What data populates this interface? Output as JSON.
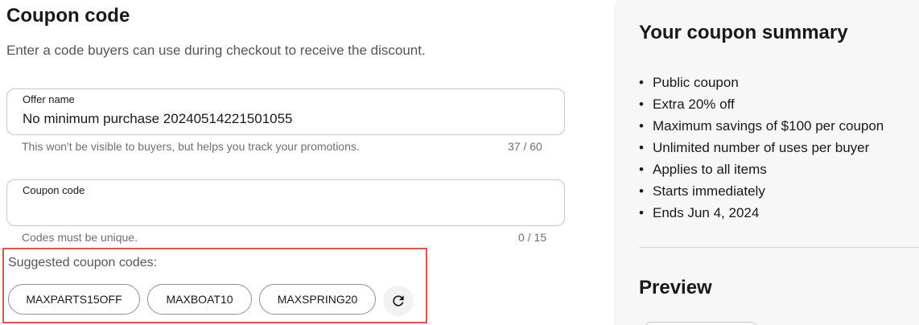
{
  "coupon_section": {
    "title": "Coupon code",
    "description": "Enter a code buyers can use during checkout to receive the discount."
  },
  "offer_name_field": {
    "label": "Offer name",
    "value": "No minimum purchase 20240514221501055",
    "helper": "This won't be visible to buyers, but helps you track your promotions.",
    "counter": "37 / 60"
  },
  "coupon_code_field": {
    "label": "Coupon code",
    "value": "",
    "helper": "Codes must be unique.",
    "counter": "0 / 15"
  },
  "suggestions": {
    "label": "Suggested coupon codes:",
    "codes": [
      "MAXPARTS15OFF",
      "MAXBOAT10",
      "MAXSPRING20"
    ],
    "refresh_icon": "refresh-icon"
  },
  "summary": {
    "title": "Your coupon summary",
    "items": [
      "Public coupon",
      "Extra 20% off",
      "Maximum savings of $100 per coupon",
      "Unlimited number of uses per buyer",
      "Applies to all items",
      "Starts immediately",
      "Ends Jun 4, 2024"
    ],
    "bullet": "•"
  },
  "preview": {
    "title": "Preview"
  },
  "colors": {
    "highlight_border": "#d9534f",
    "summary_bg": "#f7f7f7",
    "text": "#191919",
    "muted": "#707070"
  }
}
